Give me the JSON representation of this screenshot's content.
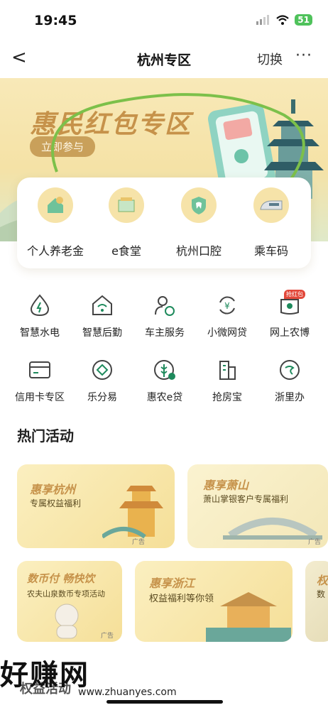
{
  "status": {
    "time": "19:45",
    "battery": "51"
  },
  "nav": {
    "back": "<",
    "title": "杭州专区",
    "switch": "切换",
    "more": "···"
  },
  "banner": {
    "title": "惠民红包专区",
    "join": "立即参与"
  },
  "quick": [
    {
      "label": "个人养老金",
      "icon": "house-coin-icon"
    },
    {
      "label": "e食堂",
      "icon": "canteen-icon"
    },
    {
      "label": "杭州口腔",
      "icon": "tooth-icon"
    },
    {
      "label": "乘车码",
      "icon": "train-icon"
    }
  ],
  "services": [
    {
      "label": "智慧水电",
      "icon": "water-drop-icon"
    },
    {
      "label": "智慧后勤",
      "icon": "house-wifi-icon"
    },
    {
      "label": "车主服务",
      "icon": "driver-icon"
    },
    {
      "label": "小微网贷",
      "icon": "yen-cycle-icon"
    },
    {
      "label": "网上农博",
      "icon": "farm-expo-icon",
      "badge": "抢红包"
    },
    {
      "label": "信用卡专区",
      "icon": "credit-card-icon"
    },
    {
      "label": "乐分易",
      "icon": "diamond-circle-icon"
    },
    {
      "label": "惠农e贷",
      "icon": "wheat-loan-icon"
    },
    {
      "label": "抢房宝",
      "icon": "buildings-icon"
    },
    {
      "label": "浙里办",
      "icon": "zheli-icon"
    }
  ],
  "hot": {
    "title": "热门活动"
  },
  "cards": [
    {
      "title": "惠享杭州",
      "sub": "专属权益福利",
      "ad": "广告"
    },
    {
      "title": "惠享萧山",
      "sub": "萧山掌银客户专属福利",
      "ad": "广告"
    },
    {
      "title": "数币付 畅快饮",
      "sub": "农夫山泉数币专项活动",
      "ad": "广告"
    },
    {
      "title": "惠享浙江",
      "sub": "权益福利等你领",
      "ad": ""
    },
    {
      "title": "权",
      "sub": "数",
      "ad": ""
    }
  ],
  "bottom_partial": "权益活动",
  "watermark": {
    "text": "好赚网",
    "url": "www.zhuanyes.com"
  },
  "colors": {
    "accent": "#c6924a",
    "green": "#1e8a5c",
    "banner_bg": "#f8e9b8"
  }
}
